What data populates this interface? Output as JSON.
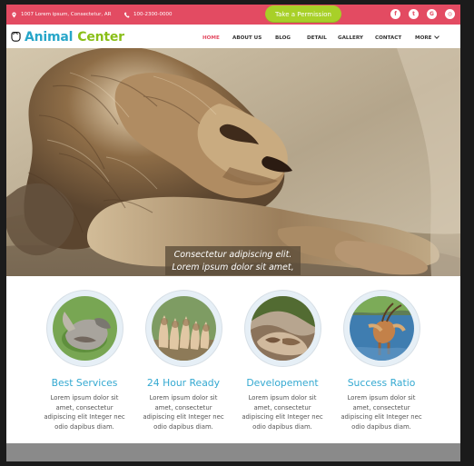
{
  "topbar": {
    "address": "1007 Lorem ipsum, Consectetur, AR",
    "phone": "100-2300-0000",
    "permission_button": "Take a Permission",
    "social_icons": [
      "facebook-icon",
      "twitter-icon",
      "google-plus-icon",
      "instagram-icon"
    ],
    "colors": {
      "topbar": "#e34b62",
      "button": "#a8d028"
    }
  },
  "navbar": {
    "logo_animal": "Animal",
    "logo_center": "Center",
    "items": [
      "HOME",
      "ABOUT US",
      "BLOG",
      "DETAIL",
      "GALLERY",
      "CONTACT",
      "MORE"
    ],
    "active_item": "HOME",
    "colors": {
      "active": "#e34b62",
      "logo_blue": "#27a6c9",
      "logo_green": "#8abf19"
    }
  },
  "hero": {
    "caption_line1": "Consectetur adipiscing elit.",
    "caption_line2": "Lorem ipsum dolor sit amet,"
  },
  "features": [
    {
      "title": "Best Services",
      "text": "Lorem ipsum dolor sit amet, consectetur adipiscing elit Integer nec odio dapibus diam."
    },
    {
      "title": "24 Hour Ready",
      "text": "Lorem ipsum dolor sit amet, consectetur adipiscing elit Integer nec odio dapibus diam."
    },
    {
      "title": "Developement",
      "text": "Lorem ipsum dolor sit amet, consectetur adipiscing elit Integer nec odio dapibus diam."
    },
    {
      "title": "Success Ratio",
      "text": "Lorem ipsum dolor sit amet, consectetur adipiscing elit Integer nec odio dapibus diam."
    }
  ]
}
